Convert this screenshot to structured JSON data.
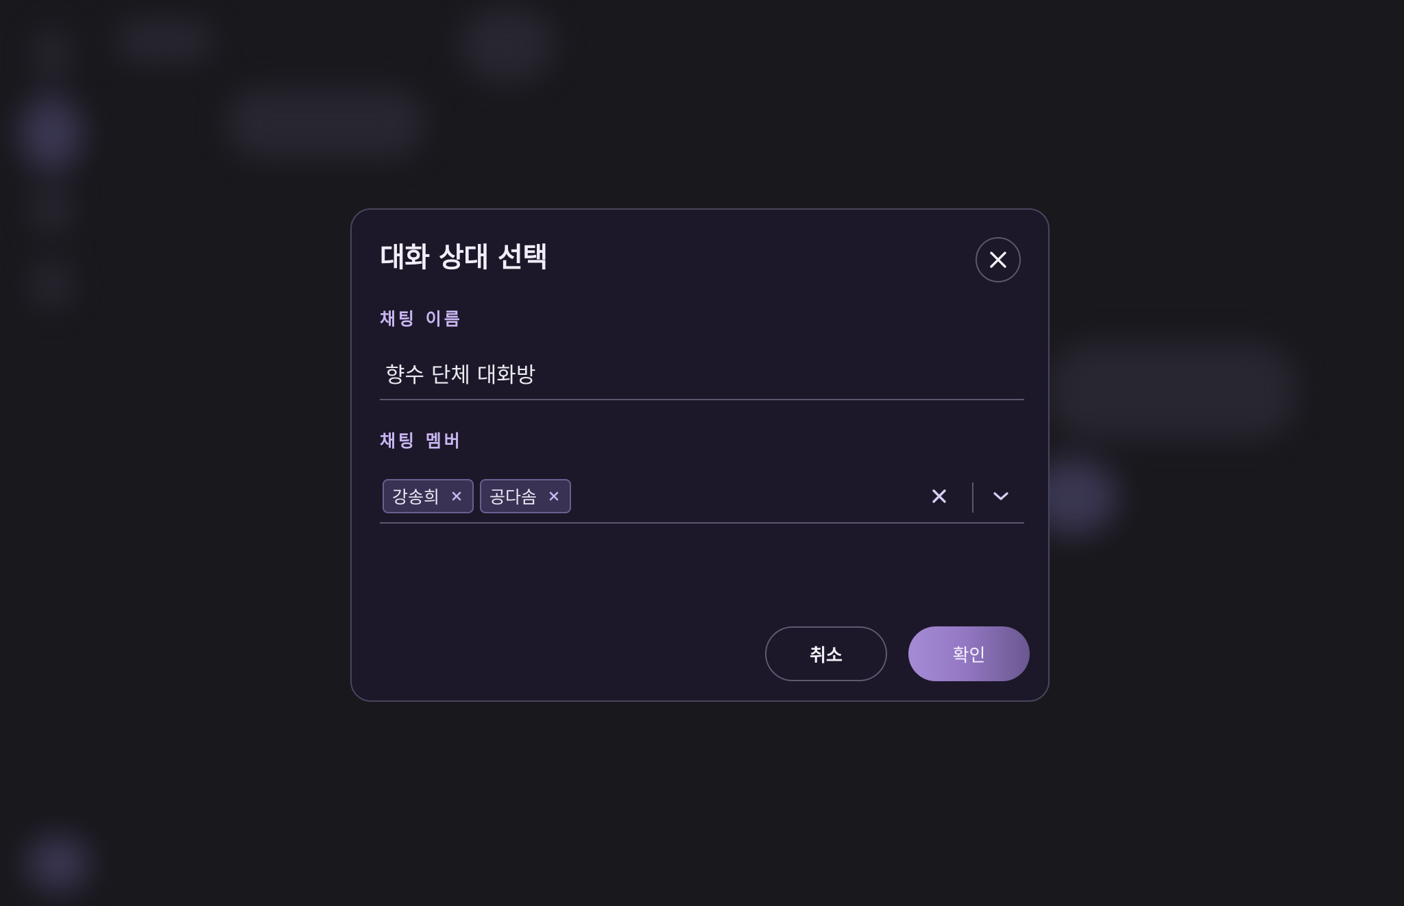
{
  "dialog": {
    "title": "대화 상대 선택",
    "close_icon": "close-icon"
  },
  "chat_name": {
    "label": "채팅 이름",
    "value": "향수 단체 대화방"
  },
  "chat_members": {
    "label": "채팅 멤버",
    "chips": [
      {
        "label": "강송희"
      },
      {
        "label": "공다솜"
      }
    ],
    "clear_icon": "clear-all-icon",
    "dropdown_icon": "chevron-down-icon"
  },
  "actions": {
    "cancel_label": "취소",
    "confirm_label": "확인"
  },
  "colors": {
    "background": "#19181d",
    "dialog_bg": "#1c1829",
    "accent": "#a58bd6",
    "label": "#c9b6f2",
    "chip_bg": "#3a3254"
  }
}
